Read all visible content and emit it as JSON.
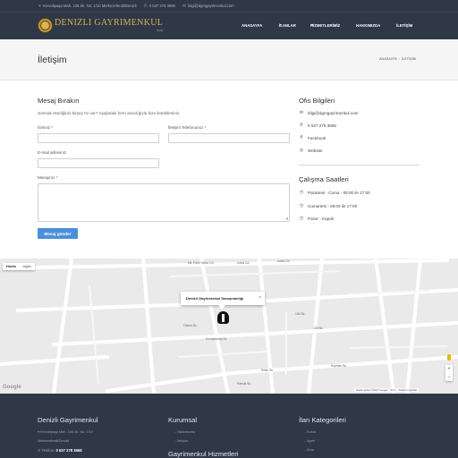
{
  "topbar": {
    "address": "Kervalipaşa Mah. 106 Sk. No: 1/10 Merkezefendi/Denizli",
    "phone": "0 537 278 3668",
    "email": "bilgi@dgmgayrimenkul.com"
  },
  "brand": {
    "title": "DENIZLI GAYRIMENKUL",
    "subtitle": "DGM"
  },
  "nav": {
    "items": [
      {
        "label": "ANASAYFA"
      },
      {
        "label": "İLANLAR"
      },
      {
        "label": "HİZMETLERİMİZ"
      },
      {
        "label": "HAKKIMIZDA"
      },
      {
        "label": "İLETİŞİM"
      }
    ]
  },
  "page": {
    "title": "İletişim",
    "breadcrumb": [
      "ANASAYFA",
      "İLETİŞİM"
    ]
  },
  "form": {
    "title": "Mesaj Bırakın",
    "description": "Sormak istediğiniz birşey mi var? Aşağıdaki form aracılığıyla bize iletebilirsiniz.",
    "name_label": "İsminiz",
    "phone_label": "İletişim Telefonunuz",
    "email_label": "E-mail adresiniz",
    "message_label": "Mesajınız",
    "required_mark": "*",
    "submit_label": "Mesaj gönder",
    "name_value": "",
    "phone_value": "",
    "email_value": "",
    "message_value": ""
  },
  "office": {
    "title": "Ofis Bilgileri",
    "items": [
      {
        "icon": "envelope-icon",
        "text": "bilgi@dgmgayrimenkul.com"
      },
      {
        "icon": "phone-icon",
        "text": "0 537 278 3668"
      },
      {
        "icon": "facebook-icon",
        "text": "Facebook"
      },
      {
        "icon": "globe-icon",
        "text": "Website"
      }
    ]
  },
  "hours": {
    "title": "Çalışma Saatleri",
    "items": [
      {
        "icon": "clock-icon",
        "text": "Pazartesi - Cuma - 09:00 ile 17:00"
      },
      {
        "icon": "clock-icon",
        "text": "Cumartesi - 09:00 ile 17:00"
      },
      {
        "icon": "clock-icon",
        "text": "Pazar - Kapalı"
      }
    ]
  },
  "map": {
    "type_map": "Harita",
    "type_satellite": "Uydu",
    "info_title": "Denizli Gayrimenkul Danışmanlığı",
    "close_symbol": "×",
    "roads": [
      "Mil. Fahri Yalçın Cd.",
      "İnönü Cd.",
      "İnönü Cd.",
      "106 Sk.",
      "105 Sk.",
      "Özbek Sk.",
      "Kervansaray Sk.",
      "Kaymak Sk.",
      "Selim Sk.",
      "Pamuk Sk."
    ],
    "google": "Google",
    "footer_data": "Harita verileri ©2017 Google",
    "footer_scale": "50 m",
    "footer_terms": "Kullanım Şartları",
    "zoom_in": "+",
    "zoom_out": "−"
  },
  "footer": {
    "col1_title": "Denizli Gayrimenkul",
    "col1_address_line1": "Kervalipaşa Mah. 106 Sk. No: 1/10",
    "col1_address_line2": "Merkezefendi/Denizli",
    "col1_phone_label": "Telefon:",
    "col1_phone": "0 537 278 3668",
    "col2_title": "Kurumsal",
    "col2_links": [
      "Hakkımızda",
      "İletişim"
    ],
    "col2_title2": "Gayrimenkul Hizmetleri",
    "col3_title": "İlan Kategorileri",
    "col3_links": [
      "Konut",
      "İşyeri",
      "Arsa"
    ]
  },
  "colors": {
    "header_bg": "#2f3847",
    "accent_gold": "#d4b257",
    "button_blue": "#4a90d6",
    "page_head_bg": "#f5f5f5"
  }
}
